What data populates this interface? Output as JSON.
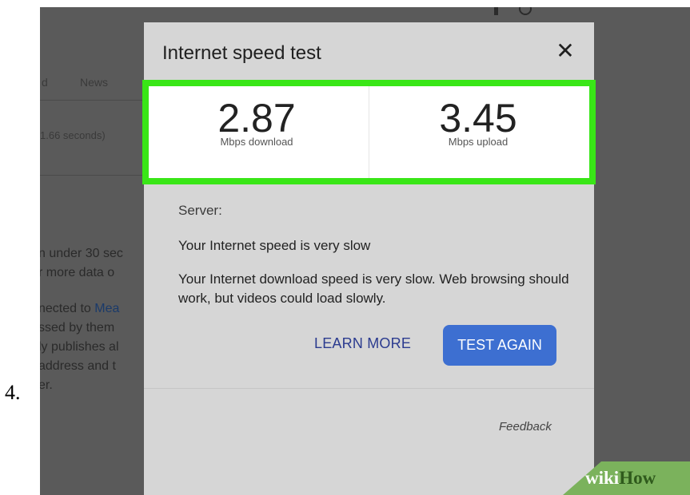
{
  "step_number": "4.",
  "background_page": {
    "tab_left": "d",
    "tab_news": "News",
    "results_stats": "1.66 seconds)",
    "body_lines": [
      "n under 30 sec",
      "r more data o",
      "nected to ",
      "ssed by them",
      "ly publishes al",
      "address and t",
      "er."
    ],
    "link_text": "Mea"
  },
  "dialog": {
    "title": "Internet speed test",
    "close_glyph": "✕",
    "download": {
      "value": "2.87",
      "unit": "Mbps download"
    },
    "upload": {
      "value": "3.45",
      "unit": "Mbps upload"
    },
    "server_label": "Server:",
    "speed_summary": "Your Internet speed is very slow",
    "speed_detail": "Your Internet download speed is very slow. Web browsing should work, but videos could load slowly.",
    "learn_more_label": "LEARN MORE",
    "test_again_label": "TEST AGAIN",
    "feedback_label": "Feedback"
  },
  "watermark": {
    "part1": "wiki",
    "part2": "How"
  },
  "colors": {
    "highlight": "#39e617",
    "primary_button": "#3d6fd1",
    "dialog_bg": "#d6d6d6",
    "backdrop": "#5a5a5a"
  }
}
